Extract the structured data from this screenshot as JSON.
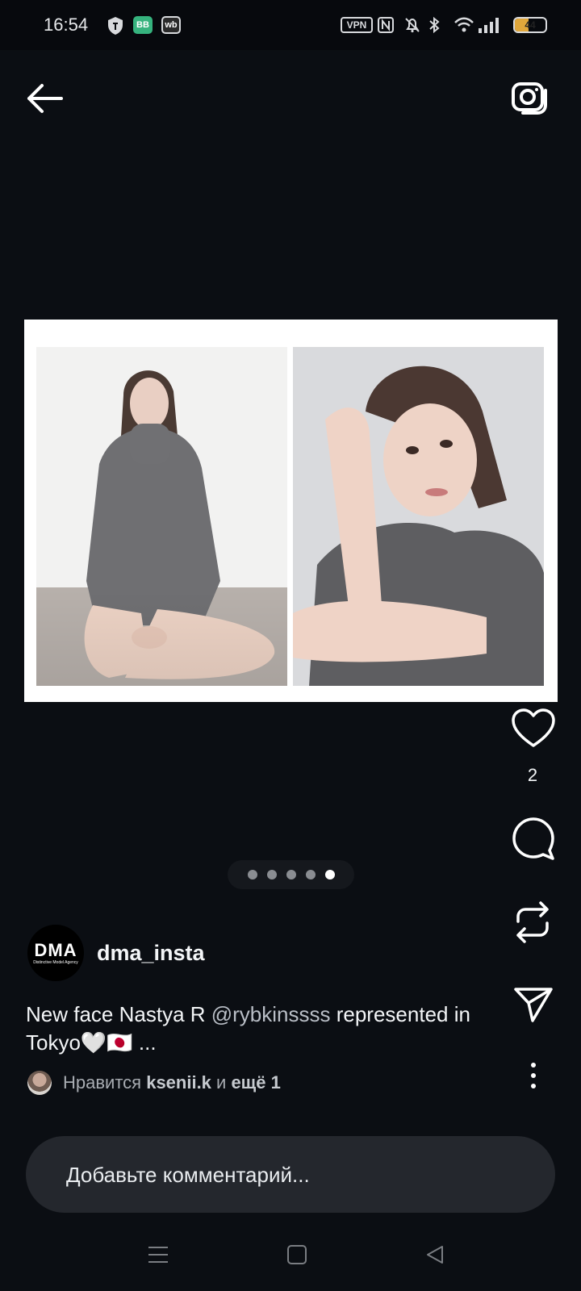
{
  "status_bar": {
    "time": "16:54",
    "vpn": "VPN",
    "battery": "44",
    "battery_level": 0.44,
    "icons": [
      "shield-icon",
      "bb-app-icon",
      "wb-app-icon",
      "vpn-icon",
      "nfc-icon",
      "bell-off-icon",
      "bluetooth-icon",
      "wifi-icon",
      "signal-icon",
      "battery-icon"
    ],
    "bb_label": "BB",
    "wb_label": "wb"
  },
  "header": {
    "back_icon": "arrow-left-icon",
    "camera_icon": "camera-icon"
  },
  "post": {
    "carousel": {
      "total": 5,
      "current": 5
    },
    "author": {
      "username": "dma_insta",
      "avatar_text": "DMA",
      "avatar_subtext": "Distinctive Model Agency"
    },
    "caption_start": "New face Nastya R ",
    "caption_mention": "@rybkinssss",
    "caption_end": " represented in Tokyo🤍🇯🇵 ...",
    "likes": {
      "prefix": "Нравится ",
      "user": "ksenii.k",
      "middle": " и ",
      "more": "ещё 1"
    },
    "like_count": "2"
  },
  "comment": {
    "placeholder": "Добавьте комментарий..."
  },
  "colors": {
    "background": "#0b0e13",
    "comment_bar": "#24272d",
    "battery": "#e0a73b",
    "bb_app": "#36b37e"
  }
}
